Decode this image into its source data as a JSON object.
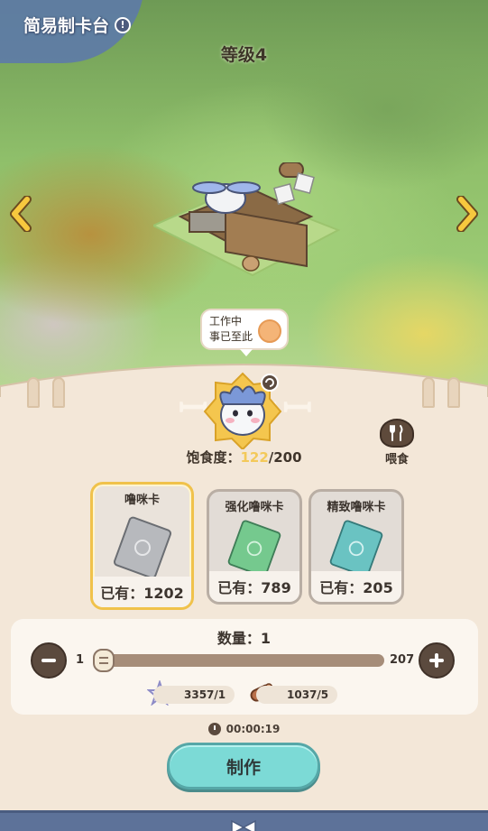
{
  "header": {
    "title": "简易制卡台",
    "info_icon": "info-icon",
    "level_label": "等级4"
  },
  "status_bubble": {
    "line1": "工作中",
    "line2": "事已至此",
    "face_icon": "sad-face-icon"
  },
  "pet": {
    "satiety_label": "饱食度：",
    "satiety_current": "122",
    "satiety_max": "/200",
    "feed_label": "喂食"
  },
  "cards": [
    {
      "name": "噜咪卡",
      "owned": "已有：1202",
      "color": "#b7b9bd",
      "selected": true
    },
    {
      "name": "强化噜咪卡",
      "owned": "已有：789",
      "color": "#75c98e",
      "selected": false
    },
    {
      "name": "精致噜咪卡",
      "owned": "已有：205",
      "color": "#6ac3c2",
      "selected": false
    }
  ],
  "quantity": {
    "title": "数量：1",
    "min": "1",
    "max": "207",
    "value": 1,
    "max_value": 207
  },
  "resources": [
    {
      "icon": "star-icon",
      "text": "3357/1"
    },
    {
      "icon": "wood-log-icon",
      "text": "1037/5"
    }
  ],
  "timer": "00:00:19",
  "make_button": "制作",
  "colors": {
    "accent_gold": "#f0c24b",
    "make_button": "#7cdad6",
    "panel_bg": "#f3e7d8",
    "dark_brown": "#5b4a3e"
  }
}
